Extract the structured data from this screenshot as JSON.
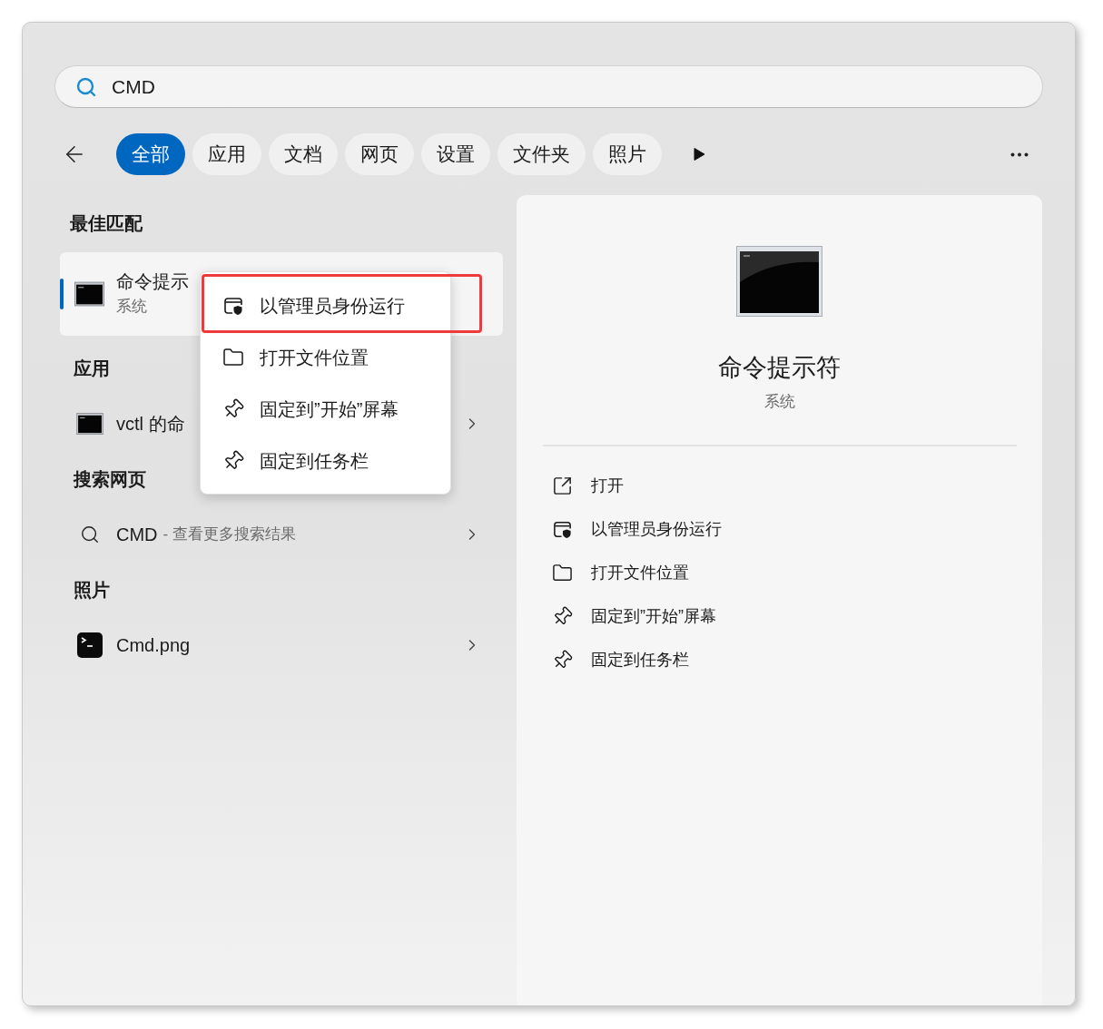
{
  "search": {
    "value": "CMD"
  },
  "filters": [
    {
      "label": "全部",
      "selected": true
    },
    {
      "label": "应用",
      "selected": false
    },
    {
      "label": "文档",
      "selected": false
    },
    {
      "label": "网页",
      "selected": false
    },
    {
      "label": "设置",
      "selected": false
    },
    {
      "label": "文件夹",
      "selected": false
    },
    {
      "label": "照片",
      "selected": false
    }
  ],
  "best_match": {
    "heading": "最佳匹配",
    "title": "命令提示",
    "subtitle": "系统",
    "selected": true
  },
  "sections": [
    {
      "heading": "应用",
      "items": [
        {
          "kind": "app",
          "title": "vctl 的命"
        }
      ]
    },
    {
      "heading": "搜索网页",
      "items": [
        {
          "kind": "web",
          "title": "CMD",
          "suffix": "- 查看更多搜索结果"
        }
      ]
    },
    {
      "heading": "照片",
      "items": [
        {
          "kind": "photo",
          "title": "Cmd.png"
        }
      ]
    }
  ],
  "context_menu": {
    "items": [
      {
        "kind": "admin",
        "label": "以管理员身份运行",
        "highlighted": true
      },
      {
        "kind": "folder",
        "label": "打开文件位置",
        "highlighted": false
      },
      {
        "kind": "pin",
        "label": "固定到”开始”屏幕",
        "highlighted": false
      },
      {
        "kind": "pin",
        "label": "固定到任务栏",
        "highlighted": false
      }
    ]
  },
  "detail": {
    "title": "命令提示符",
    "subtitle": "系统",
    "actions": [
      {
        "kind": "open",
        "label": "打开"
      },
      {
        "kind": "admin",
        "label": "以管理员身份运行"
      },
      {
        "kind": "folder",
        "label": "打开文件位置"
      },
      {
        "kind": "pin",
        "label": "固定到”开始”屏幕"
      },
      {
        "kind": "pin",
        "label": "固定到任务栏"
      }
    ]
  }
}
